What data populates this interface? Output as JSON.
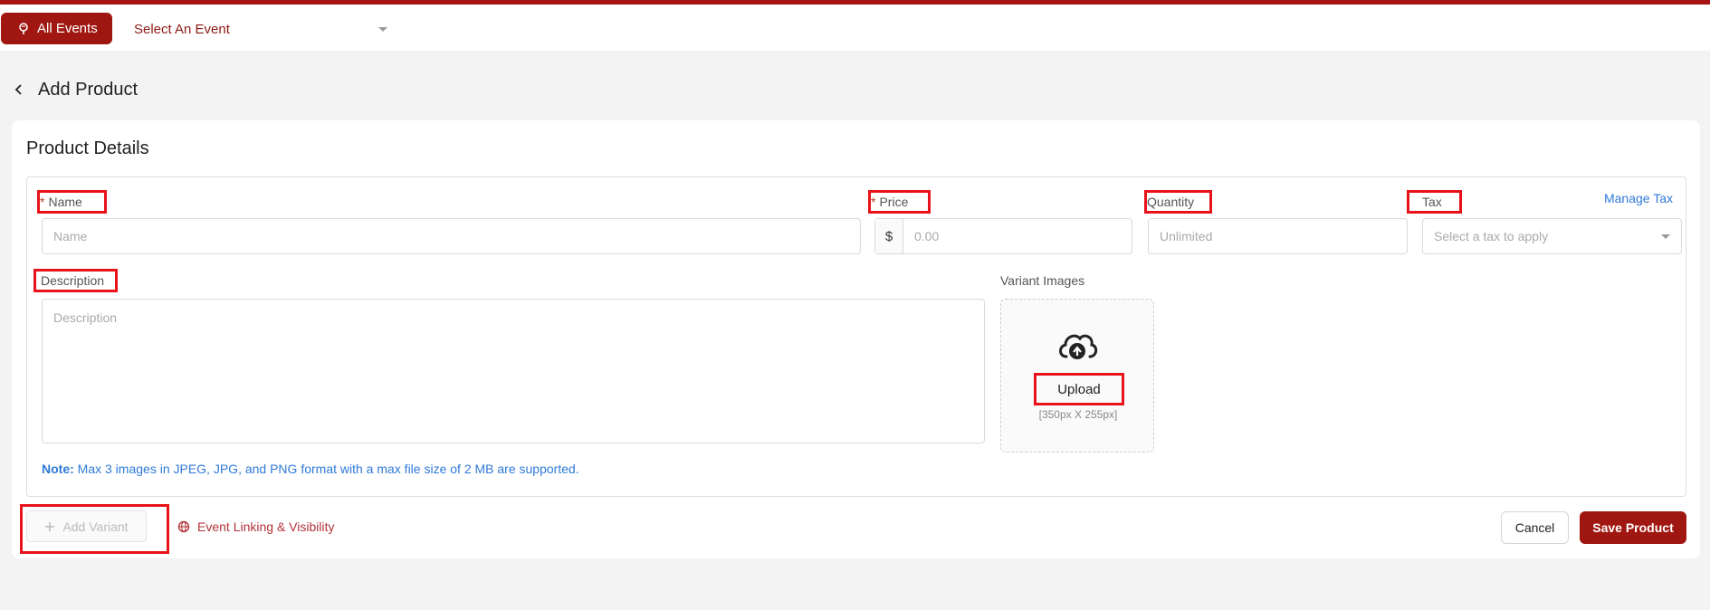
{
  "topbar": {
    "all_events_label": "All Events",
    "event_select_value": "Select An Event"
  },
  "page": {
    "title": "Add Product"
  },
  "product_details": {
    "section_title": "Product Details",
    "name": {
      "label": "Name",
      "required_marker": "*",
      "placeholder": "Name"
    },
    "price": {
      "label": "Price",
      "required_marker": "*",
      "currency_prefix": "$",
      "placeholder": "0.00"
    },
    "quantity": {
      "label": "Quantity",
      "placeholder": "Unlimited"
    },
    "tax": {
      "label": "Tax",
      "placeholder": "Select a tax to apply",
      "manage_link": "Manage Tax"
    },
    "description": {
      "label": "Description",
      "placeholder": "Description"
    },
    "variant_images": {
      "label": "Variant Images",
      "upload_label": "Upload",
      "size_hint": "[350px X 255px]"
    },
    "note": {
      "prefix": "Note:",
      "text": " Max 3 images in JPEG, JPG, and PNG format with a max file size of 2 MB are supported."
    }
  },
  "footer": {
    "add_variant_label": "Add Variant",
    "event_linking_label": "Event Linking & Visibility",
    "cancel_label": "Cancel",
    "save_label": "Save Product"
  },
  "colors": {
    "brand": "#a01712",
    "link": "#2f7ad8",
    "highlight": "#e8131a"
  }
}
